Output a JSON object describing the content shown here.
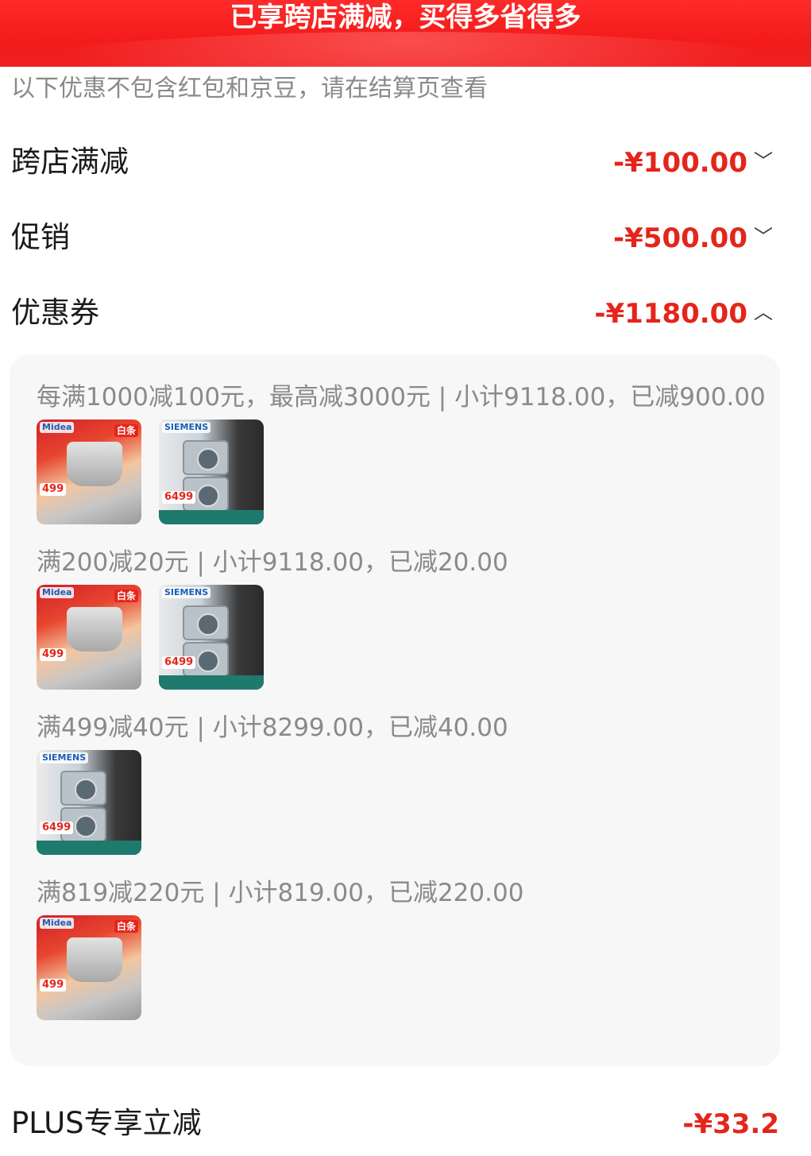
{
  "banner": {
    "title": "已享跨店满减，买得多省得多"
  },
  "note": "以下优惠不包含红包和京豆，请在结算页查看",
  "rows": [
    {
      "label": "跨店满减",
      "amount": "-¥100.00",
      "chevron": "chevron-down-icon"
    },
    {
      "label": "促销",
      "amount": "-¥500.00",
      "chevron": "chevron-down-icon"
    },
    {
      "label": "优惠券",
      "amount": "-¥1180.00",
      "chevron": "chevron-up-icon"
    }
  ],
  "coupon_tiers": [
    {
      "text": "每满1000减100元，最高减3000元 | 小计9118.00，已减900.00",
      "products": [
        "midea-pot",
        "siemens-washer"
      ]
    },
    {
      "text": "满200减20元 | 小计9118.00，已减20.00",
      "products": [
        "midea-pot",
        "siemens-washer"
      ]
    },
    {
      "text": "满499减40元 | 小计8299.00，已减40.00",
      "products": [
        "siemens-washer"
      ]
    },
    {
      "text": "满819减220元 | 小计819.00，已减220.00",
      "products": [
        "midea-pot"
      ]
    }
  ],
  "product_thumbs": {
    "midea-pot": {
      "brand": "Midea",
      "tag": "白条",
      "price": "499"
    },
    "siemens-washer": {
      "brand": "SIEMENS",
      "tag": "",
      "price": "6499"
    }
  },
  "plus_row": {
    "label": "PLUS专享立减",
    "amount": "-¥33.2"
  },
  "colors": {
    "accent": "#e4251b",
    "banner": "#f31b1b",
    "panel_bg": "#f7f7f7"
  }
}
